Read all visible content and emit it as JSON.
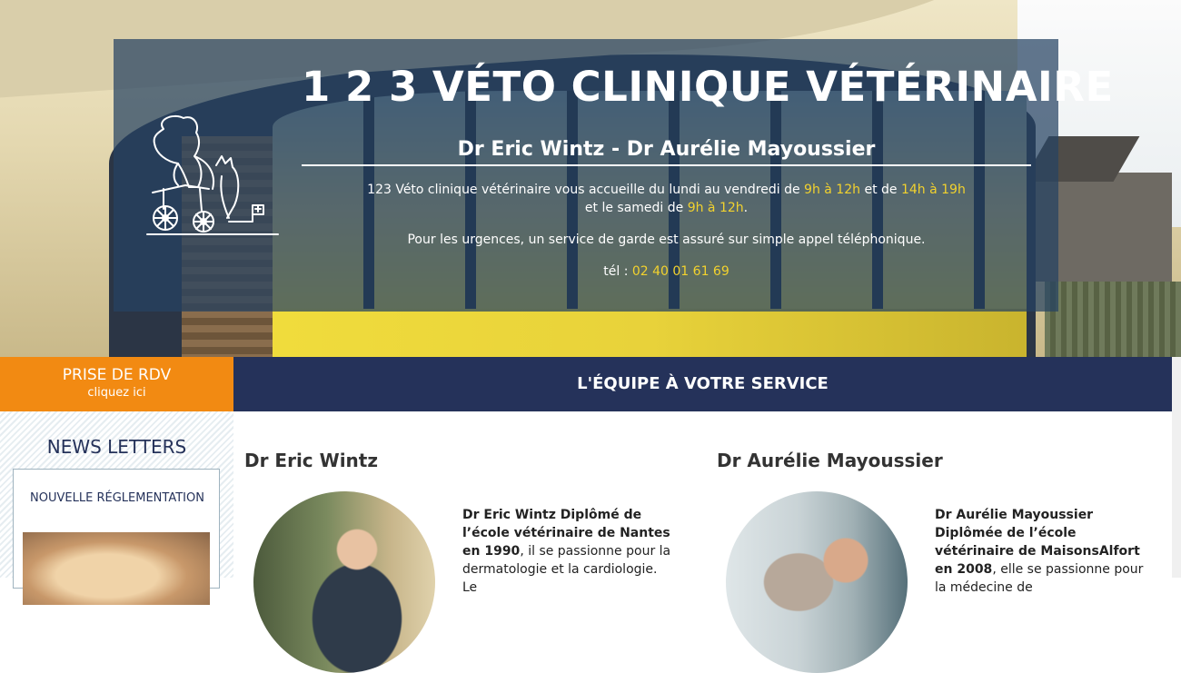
{
  "hero": {
    "title": "1 2 3 VÉTO CLINIQUE VÉTÉRINAIRE",
    "subtitle": "Dr Eric Wintz - Dr Aurélie Mayoussier",
    "hours_intro": "123 Véto clinique vétérinaire vous accueille du lundi au vendredi de",
    "hours_weekday_1": "9h à 12h",
    "hours_and": "et de",
    "hours_weekday_2": "14h à 19h",
    "hours_saturday_prefix": "et le samedi de",
    "hours_saturday": "9h à 12h",
    "hours_saturday_suffix": ".",
    "emergency": "Pour les urgences, un service de garde est assuré sur simple appel téléphonique.",
    "phone_label": "tél :",
    "phone": "02 40 01 61 69",
    "highlight_color": "#f2d22e"
  },
  "rdv": {
    "title": "PRISE DE RDV",
    "subtitle": "cliquez ici",
    "color": "#f28a12"
  },
  "team_band": {
    "title": "L'ÉQUIPE À VOTRE SERVICE",
    "color": "#25325a"
  },
  "sidebar": {
    "title": "NEWS LETTERS",
    "card_title": "NOUVELLE RÉGLEMENTATION"
  },
  "team": [
    {
      "name": "Dr Eric Wintz",
      "bio_bold": "Dr Eric Wintz Diplômé de l’école vétérinaire de Nantes en 1990",
      "bio_rest": ", il se passionne pour la dermatologie et la cardiologie. Le"
    },
    {
      "name": "Dr Aurélie Mayoussier",
      "bio_bold": "Dr Aurélie Mayoussier Diplômée de l’école vétérinaire de MaisonsAlfort en 2008",
      "bio_rest": ", elle se passionne pour la médecine de"
    }
  ]
}
